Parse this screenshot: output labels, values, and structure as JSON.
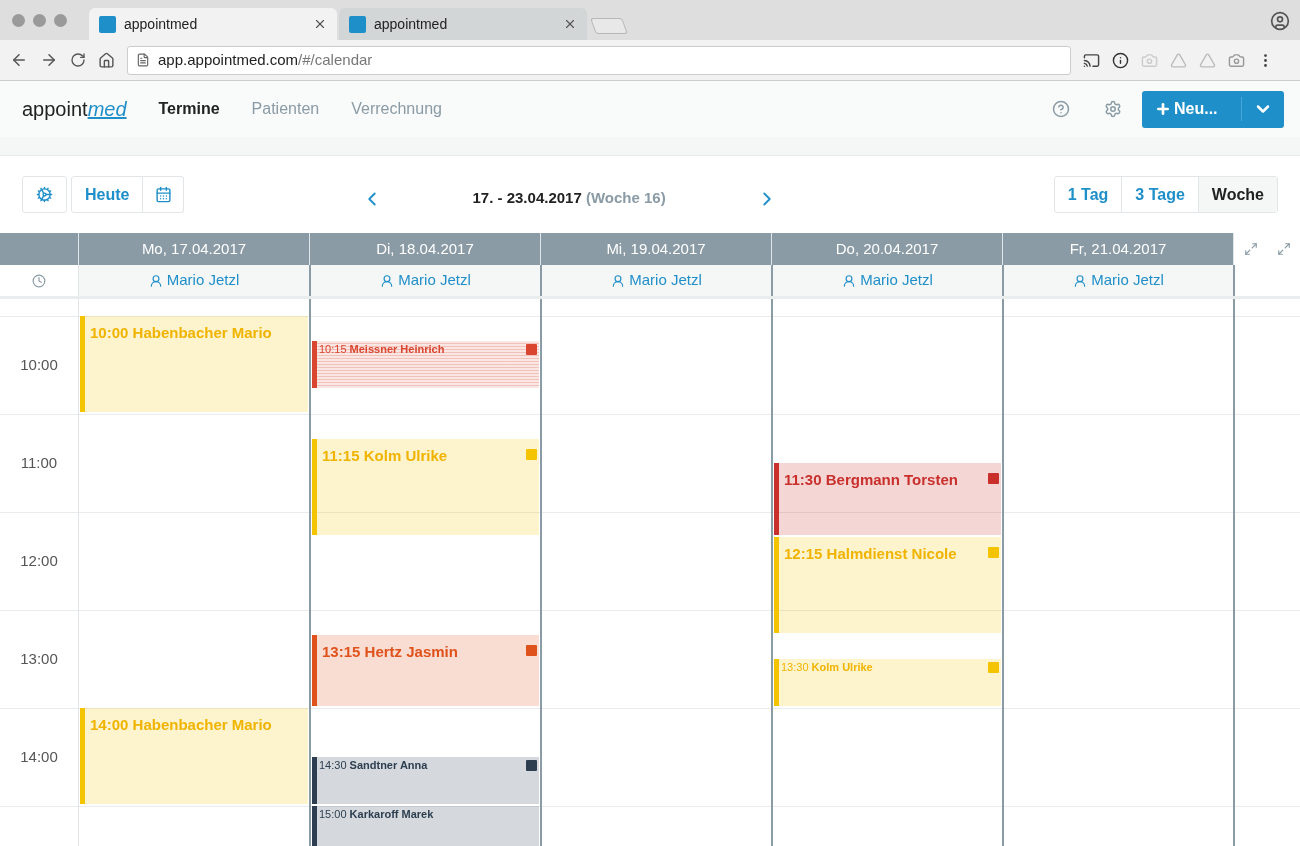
{
  "browser": {
    "tabs": [
      {
        "title": "appointmed",
        "selected": true
      },
      {
        "title": "appointmed",
        "selected": false
      }
    ],
    "url_host": "app.appointmed.com",
    "url_path": "/#/calendar"
  },
  "app": {
    "logo": {
      "main": "appoint",
      "accent": "med"
    },
    "nav": [
      {
        "label": "Termine",
        "selected": true
      },
      {
        "label": "Patienten",
        "selected": false
      },
      {
        "label": "Verrechnung",
        "selected": false
      }
    ],
    "new_button": "Neu..."
  },
  "toolbar": {
    "today": "Heute",
    "range": "17. - 23.04.2017",
    "week": "(Woche 16)",
    "views": [
      {
        "label": "1 Tag",
        "selected": false
      },
      {
        "label": "3 Tage",
        "selected": false
      },
      {
        "label": "Woche",
        "selected": true
      }
    ]
  },
  "calendar": {
    "hours": [
      "10:00",
      "11:00",
      "12:00",
      "13:00",
      "14:00"
    ],
    "days": [
      {
        "date": "Mo, 17.04.2017",
        "staff": "Mario Jetzl",
        "events": [
          {
            "time": "10:00",
            "name": "Habenbacher Mario",
            "kind": "long",
            "color": "#f5c400",
            "note": false,
            "striped": false
          },
          {
            "time": "14:00",
            "name": "Habenbacher Mario",
            "kind": "long",
            "color": "#f5c400",
            "note": false,
            "striped": false
          }
        ]
      },
      {
        "date": "Di, 18.04.2017",
        "staff": "Mario Jetzl",
        "events": [
          {
            "time": "10:15",
            "name": "Meissner Heinrich",
            "kind": "short",
            "color": "#d9452f",
            "note": true,
            "striped": true
          },
          {
            "time": "11:15",
            "name": "Kolm Ulrike",
            "kind": "long",
            "color": "#f5c400",
            "note": true,
            "striped": false
          },
          {
            "time": "13:15",
            "name": "Hertz Jasmin",
            "kind": "medium",
            "color": "#e0521c",
            "note": true,
            "striped": false
          },
          {
            "time": "14:30",
            "name": "Sandtner Anna",
            "kind": "short",
            "color": "#2c3e50",
            "note": true,
            "striped": false
          },
          {
            "time": "15:00",
            "name": "Karkaroff Marek",
            "kind": "short",
            "color": "#2c3e50",
            "note": false,
            "striped": false
          }
        ]
      },
      {
        "date": "Mi, 19.04.2017",
        "staff": "Mario Jetzl"
      },
      {
        "date": "Do, 20.04.2017",
        "staff": "Mario Jetzl",
        "events": [
          {
            "time": "11:30",
            "name": "Bergmann Torsten",
            "kind": "medium",
            "color": "#c9302c",
            "note": true,
            "striped": false
          },
          {
            "time": "12:15",
            "name": "Halmdienst Nicole",
            "kind": "long",
            "color": "#f5c400",
            "note": true,
            "striped": false
          },
          {
            "time": "13:30",
            "name": "Kolm Ulrike",
            "kind": "short",
            "color": "#f5c400",
            "note": true,
            "striped": false
          }
        ]
      },
      {
        "date": "Fr, 21.04.2017",
        "staff": "Mario Jetzl"
      }
    ]
  }
}
